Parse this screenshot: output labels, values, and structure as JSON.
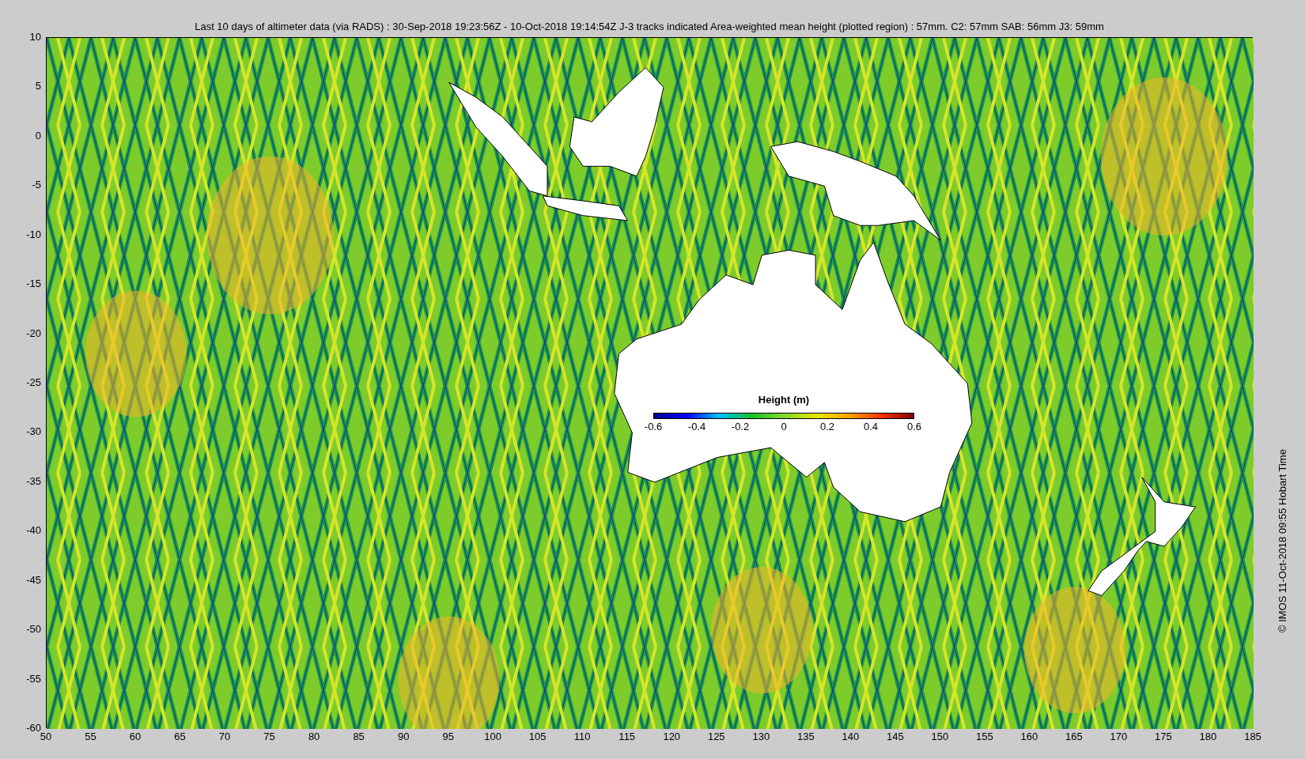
{
  "title": "Last 10 days of altimeter data (via RADS) : 30-Sep-2018 19:23:56Z - 10-Oct-2018 19:14:54Z  J-3 tracks indicated  Area-weighted mean height (plotted region) : 57mm.  C2: 57mm  SAB: 56mm  J3: 59mm",
  "map": {
    "y_ticks": [
      "10",
      "5",
      "0",
      "-5",
      "-10",
      "-15",
      "-20",
      "-25",
      "-30",
      "-35",
      "-40",
      "-45",
      "-50",
      "-55",
      "-60"
    ],
    "x_ticks": [
      "50",
      "55",
      "60",
      "65",
      "70",
      "75",
      "80",
      "85",
      "90",
      "95",
      "100",
      "105",
      "110",
      "115",
      "120",
      "125",
      "130",
      "135",
      "140",
      "145",
      "150",
      "155",
      "160",
      "165",
      "170",
      "175",
      "180",
      "185"
    ]
  },
  "colorbar": {
    "label": "Height (m)",
    "ticks": [
      "-0.6",
      "-0.4",
      "-0.2",
      "0",
      "0.2",
      "0.4",
      "0.6"
    ]
  },
  "credit": "© IMOS 11-Oct-2018 09:55 Hobart Time"
}
